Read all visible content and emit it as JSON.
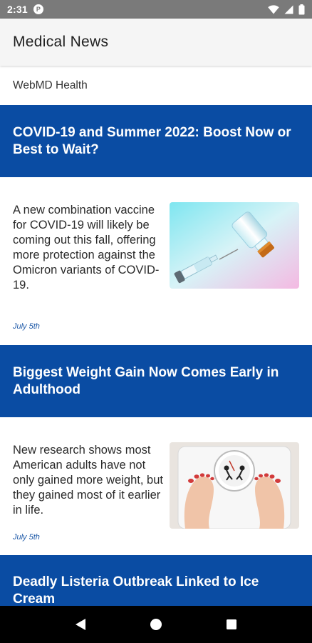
{
  "status_bar": {
    "time": "2:31",
    "app_icon": "circle-p-icon",
    "icons": [
      "wifi-icon",
      "signal-icon",
      "battery-icon"
    ]
  },
  "app_bar": {
    "title": "Medical News"
  },
  "source": {
    "label": "WebMD Health"
  },
  "articles": [
    {
      "title": "COVID-19 and Summer 2022: Boost Now or Best to Wait?",
      "summary": "A new combination vaccine for COVID-19 will likely be coming out this fall, offering more protection against the Omicron variants of COVID-19.",
      "date": "July 5th",
      "image": "vaccine-vial-syringe-image"
    },
    {
      "title": "Biggest Weight Gain Now Comes Early in Adulthood",
      "summary": "New research shows most American adults have not only gained more weight, but they gained most of it earlier in life.",
      "date": "July 5th",
      "image": "feet-on-scale-image"
    },
    {
      "title": "Deadly Listeria Outbreak Linked to Ice Cream"
    }
  ],
  "colors": {
    "headline_bg": "#0a4ca3",
    "date_text": "#1f5aa8",
    "app_bar_bg": "#f5f5f5",
    "status_bar_bg": "#7a7a7a"
  },
  "nav": {
    "buttons": [
      "back-icon",
      "home-icon",
      "recents-icon"
    ]
  }
}
